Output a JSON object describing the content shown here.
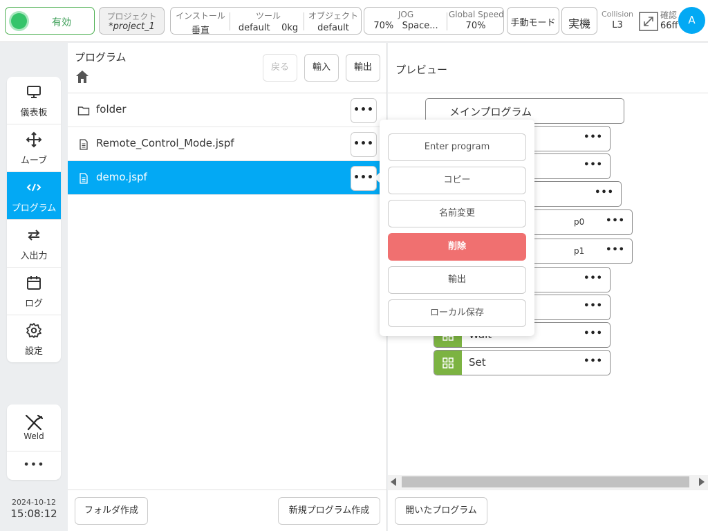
{
  "topbar": {
    "status": "有効",
    "project": {
      "label": "プロジェクト",
      "value": "*project_1"
    },
    "install": {
      "label": "インストール",
      "value": "垂直"
    },
    "tool": {
      "label": "ツール",
      "name": "default",
      "weight": "0kg"
    },
    "object": {
      "label": "オブジェクト",
      "value": "default"
    },
    "jog": {
      "label": "JOG",
      "speed": "70%",
      "frame": "Space..."
    },
    "global_speed": {
      "label": "Global Speed",
      "value": "70%"
    },
    "mode": "手動モード",
    "machine": "実機",
    "collision": {
      "label": "Collision",
      "value": "L3"
    },
    "confirm": {
      "label": "確認",
      "value": "66ff"
    },
    "avatar": "A"
  },
  "nav": {
    "items": [
      {
        "label": "儀表板",
        "icon": "monitor-icon"
      },
      {
        "label": "ムーブ",
        "icon": "move-icon"
      },
      {
        "label": "プログラム",
        "icon": "code-icon"
      },
      {
        "label": "入出力",
        "icon": "swap-icon"
      },
      {
        "label": "ログ",
        "icon": "calendar-icon"
      },
      {
        "label": "設定",
        "icon": "gear-icon"
      }
    ],
    "active_index": 2,
    "weld": "Weld",
    "more": "•••"
  },
  "datetime": {
    "date": "2024-10-12",
    "time": "15:08:12"
  },
  "program": {
    "title": "プログラム",
    "back": "戻る",
    "import": "輸入",
    "export": "輸出",
    "files": [
      {
        "name": "folder",
        "type": "folder"
      },
      {
        "name": "Remote_Control_Mode.jspf",
        "type": "file"
      },
      {
        "name": "demo.jspf",
        "type": "file"
      }
    ],
    "selected_index": 2,
    "more": "•••",
    "new_folder": "フォルダ作成",
    "new_program": "新規プログラム作成"
  },
  "preview": {
    "title": "プレビュー",
    "main_program": "メインプログラム",
    "nodes": [
      {
        "label": ""
      },
      {
        "label": ""
      },
      {
        "label": ""
      },
      {
        "label": "p0"
      },
      {
        "label": "p1"
      },
      {
        "label": ""
      },
      {
        "label": ""
      },
      {
        "label": "Wait"
      },
      {
        "label": "Set"
      }
    ],
    "more": "•••",
    "opened_programs": "開いたプログラム"
  },
  "context_menu": {
    "items": [
      "Enter program",
      "コピー",
      "名前変更",
      "削除",
      "輸出",
      "ローカル保存"
    ],
    "danger_index": 3
  },
  "colors": {
    "accent": "#03a9f4",
    "active_status": "#35c46a",
    "danger": "#f07070",
    "node_badge": "#7cb342"
  }
}
